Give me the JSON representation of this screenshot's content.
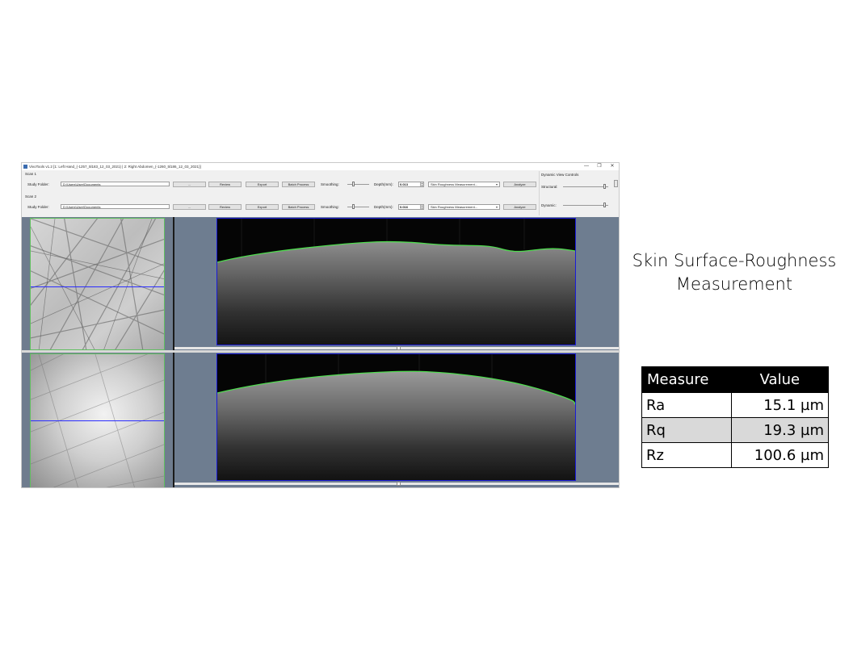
{
  "window": {
    "title": "VivoTools v1.2  [1: Left Hand_(-1257_5l183_12_03_2021)  |  2: Right Abdomen_(-1260_5l186_12_03_2021)]",
    "minimize": "—",
    "restore": "❐",
    "close": "✕"
  },
  "scans": [
    {
      "label": "Scan 1",
      "study_folder_label": "Study Folder:",
      "folder_path": "D:\\Users\\User\\Documents",
      "browse_label": "...",
      "review_label": "Review",
      "export_label": "Export",
      "batch_label": "Batch Process",
      "smoothing_label": "Smoothing:",
      "depth_label": "Depth(mm):",
      "depth_value": "0.013",
      "measurement": "Skin Roughness Measurement...",
      "analyze_label": "Analyze"
    },
    {
      "label": "Scan 2",
      "study_folder_label": "Study Folder:",
      "folder_path": "D:\\Users\\User\\Documents",
      "browse_label": "...",
      "review_label": "Review",
      "export_label": "Export",
      "batch_label": "Batch Process",
      "smoothing_label": "Smoothing:",
      "depth_label": "Depth(mm):",
      "depth_value": "0.016",
      "measurement": "Skin Roughness Measurement...",
      "analyze_label": "Analyze"
    }
  ],
  "dynamic_view": {
    "title": "Dynamic View Controls",
    "structural_label": "Structural:",
    "dynamic_label": "Dynamic:"
  },
  "caption": {
    "line1": "Skin Surface-Roughness",
    "line2": "Measurement"
  },
  "results": {
    "headers": [
      "Measure",
      "Value"
    ],
    "rows": [
      {
        "measure": "Ra",
        "value": "15.1 µm"
      },
      {
        "measure": "Rq",
        "value": "19.3 µm"
      },
      {
        "measure": "Rz",
        "value": "100.6 µm"
      }
    ]
  },
  "colors": {
    "oct_outline": "#1b1bd8",
    "surface_trace": "#4fdc4f",
    "thumb_border": "#5fbf5f",
    "scan_line": "#2a2cff"
  }
}
